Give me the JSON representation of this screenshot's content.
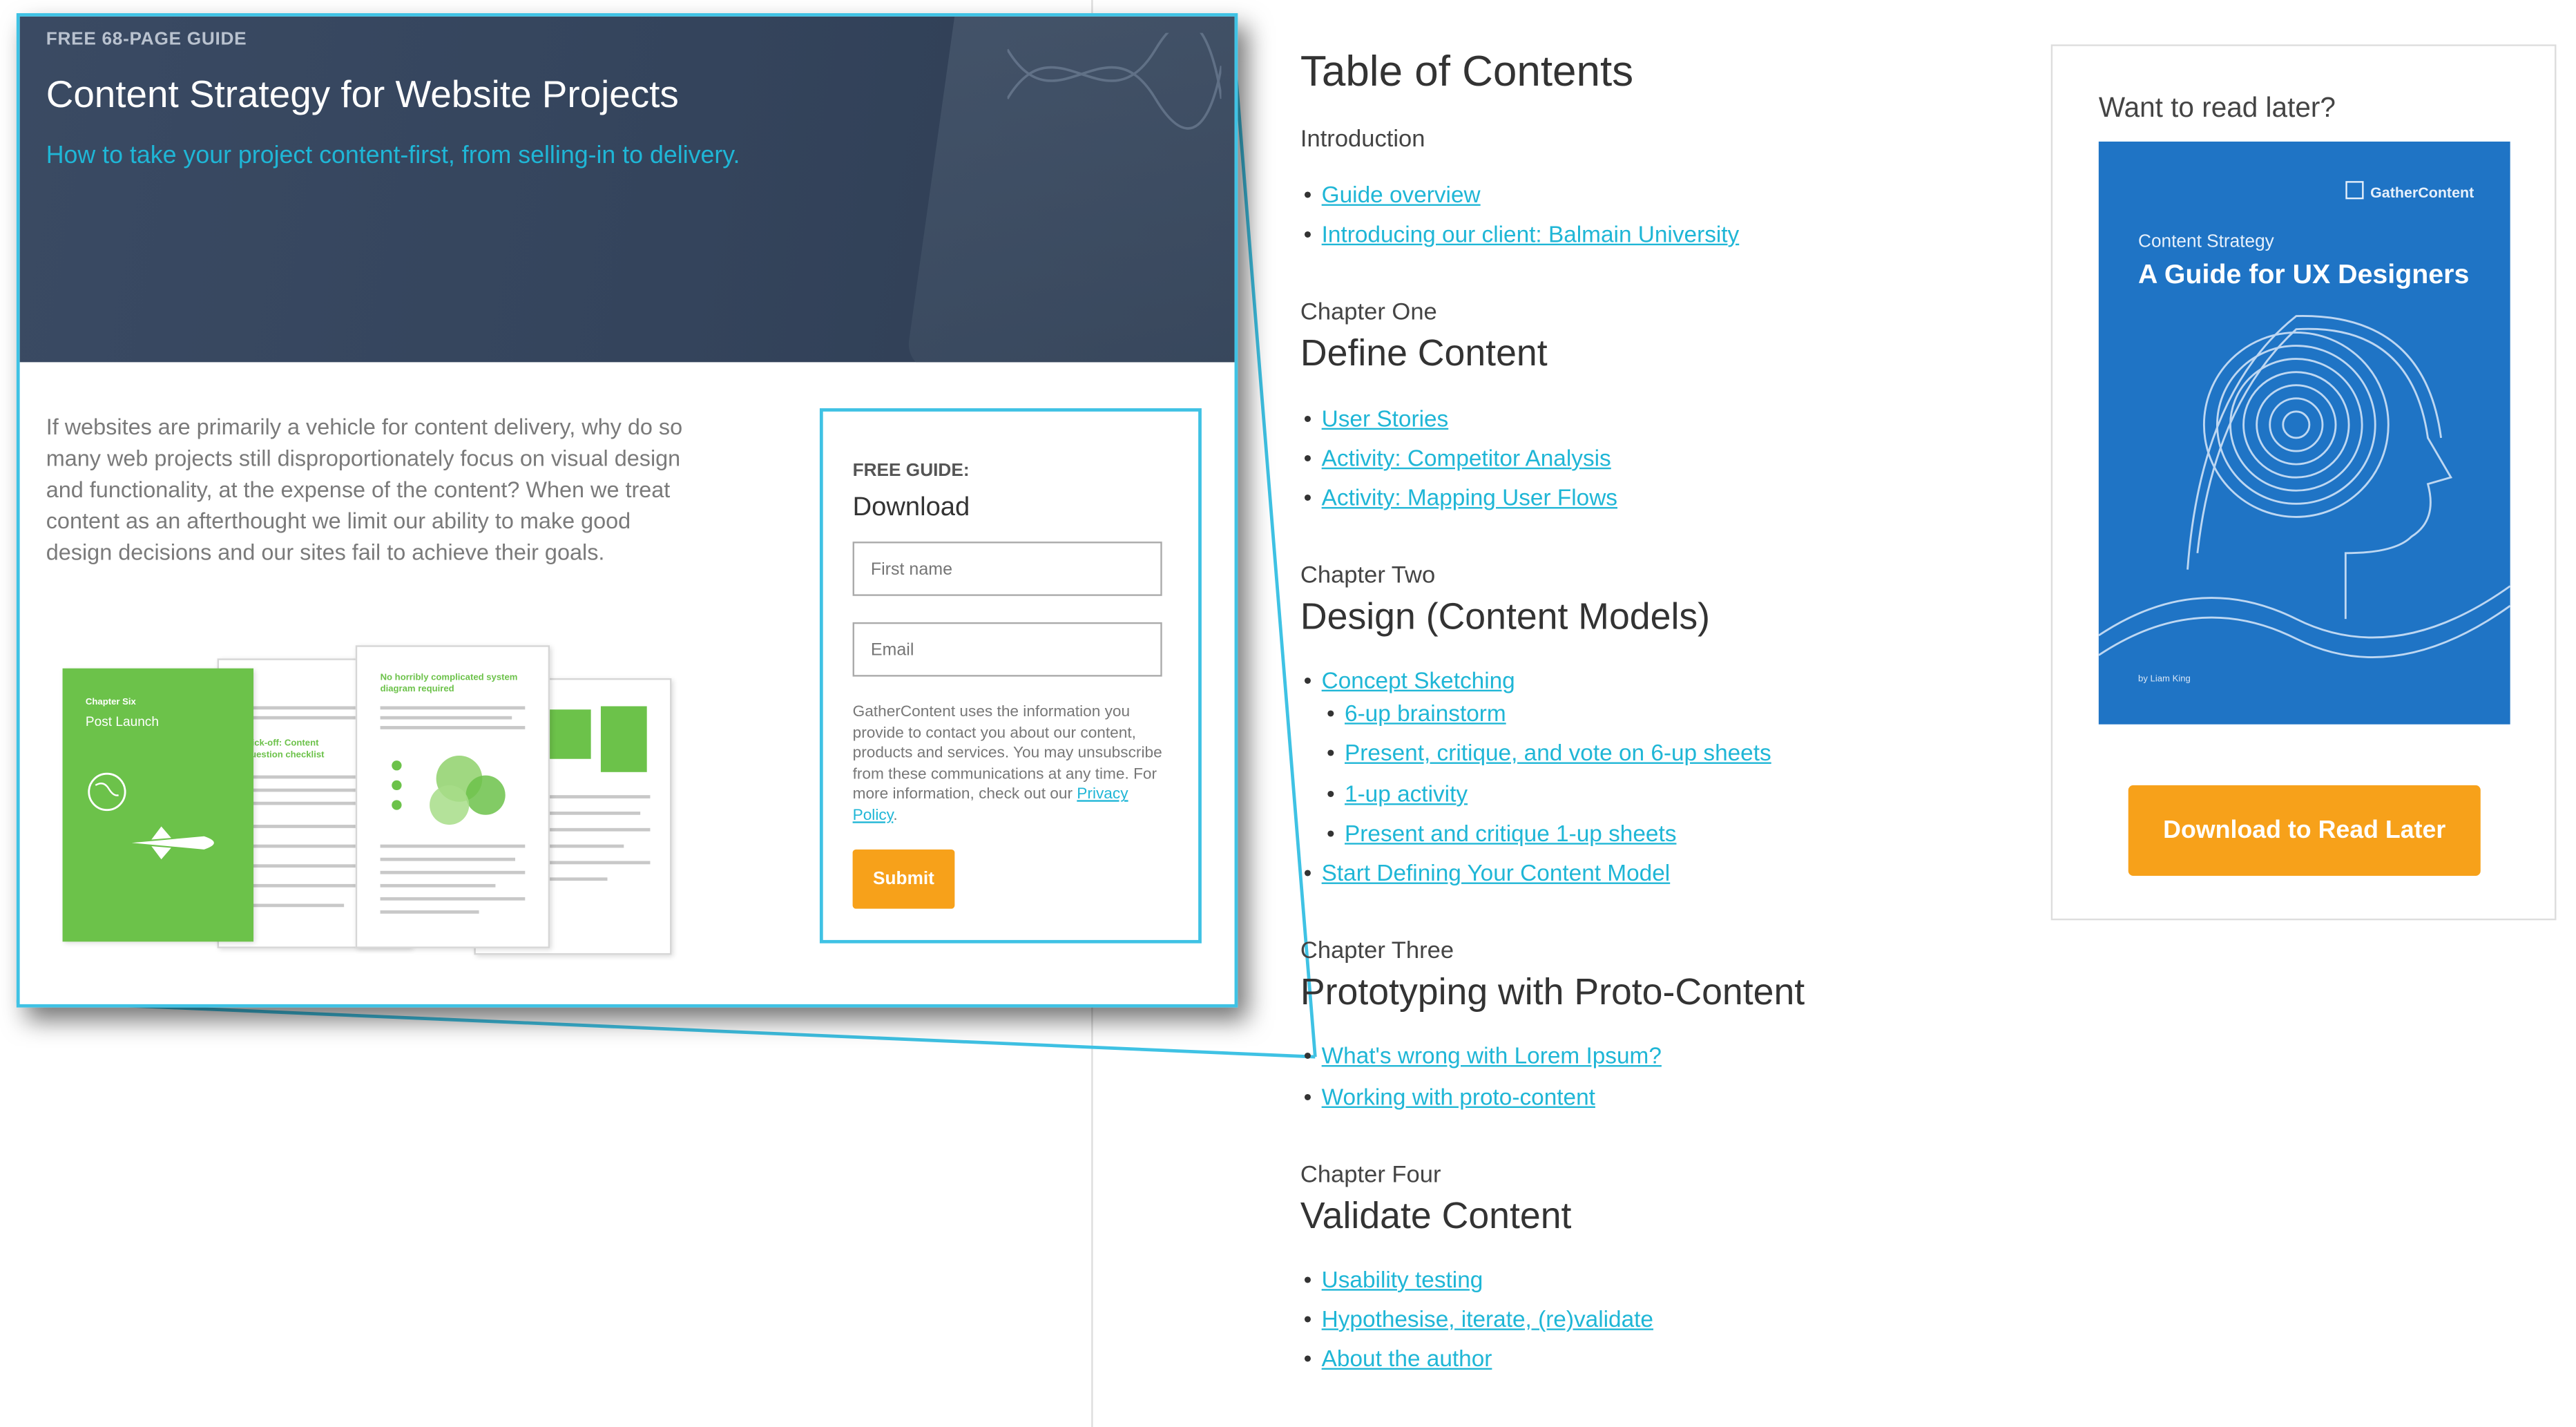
{
  "popup": {
    "kicker": "FREE 68-PAGE GUIDE",
    "title": "Content Strategy for Website Projects",
    "subtitle": "How to take your project content-first, from selling-in to delivery.",
    "intro": "If websites are primarily a vehicle for content delivery, why do so many web projects still disproportionately focus on visual design and functionality, at the expense of the content? When we treat content as an afterthought we limit our ability to make good design decisions and our sites fail to achieve their goals.",
    "preview_pages": {
      "chapter_label": "Chapter Six",
      "chapter_title": "Post Launch",
      "kickoff_heading": "Kick-off: Content question checklist",
      "diagram_heading": "No horribly complicated system diagram required"
    },
    "form": {
      "label": "FREE GUIDE:",
      "title": "Download",
      "first_name_placeholder": "First name",
      "email_placeholder": "Email",
      "disclaimer": "GatherContent uses the information you provide to contact you about our content, products and services. You may unsubscribe from these communications at any time. For more information, check out our ",
      "privacy_link": "Privacy Policy",
      "disclaimer_end": ".",
      "submit_label": "Submit"
    }
  },
  "toc": {
    "title": "Table of Contents",
    "sections": [
      {
        "eyebrow": "Introduction",
        "title": "",
        "items": [
          "Guide overview",
          "Introducing our client: Balmain University"
        ]
      },
      {
        "eyebrow": "Chapter One",
        "title": "Define Content",
        "items": [
          "User Stories",
          "Activity: Competitor Analysis",
          "Activity: Mapping User Flows"
        ]
      },
      {
        "eyebrow": "Chapter Two",
        "title": "Design (Content Models)",
        "items": [
          "Concept Sketching",
          "6-up brainstorm",
          "Present, critique, and vote on 6-up sheets",
          "1-up activity",
          "Present and critique 1-up sheets",
          "Start Defining Your Content Model"
        ]
      },
      {
        "eyebrow": "Chapter Three",
        "title": "Prototyping with Proto-Content",
        "items": [
          "What's wrong with Lorem Ipsum?",
          "Working with proto-content"
        ]
      },
      {
        "eyebrow": "Chapter Four",
        "title": "Validate Content",
        "items": [
          "Usability testing",
          "Hypothesise, iterate, (re)validate",
          "About the author"
        ]
      }
    ]
  },
  "card": {
    "heading": "Want to read later?",
    "cover": {
      "logo": "GatherContent",
      "subtitle": "Content Strategy",
      "title": "A Guide for UX Designers",
      "author": "by Liam King"
    },
    "cta_label": "Download to Read Later"
  },
  "colors": {
    "accent": "#1fb6d6",
    "zoom_border": "#3fc2e4",
    "cta": "#f7a11a",
    "hero": "#34445c",
    "cover": "#1f74c5",
    "green": "#6cc24a"
  }
}
